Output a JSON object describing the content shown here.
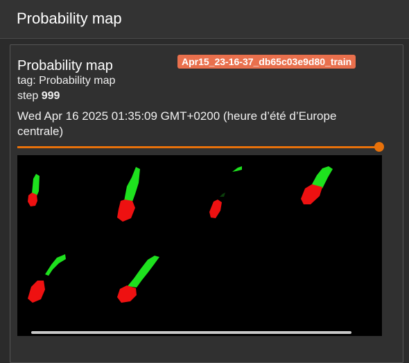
{
  "header": {
    "title": "Probability map"
  },
  "card": {
    "title": "Probability map",
    "run_name": "Apr15_23-16-37_db65c03e9d80_train",
    "tag_line": "tag: Probability map",
    "step_label": "step ",
    "step_value": "999",
    "timestamp": "Wed Apr 16 2025 01:35:09 GMT+0200 (heure d’été d’Europe centrale)",
    "slider_fraction": 1.0
  },
  "colors": {
    "accent": "#e8710a",
    "badge": "#e9704d",
    "mask_green": "#1ee11e",
    "mask_red": "#ee1111"
  }
}
